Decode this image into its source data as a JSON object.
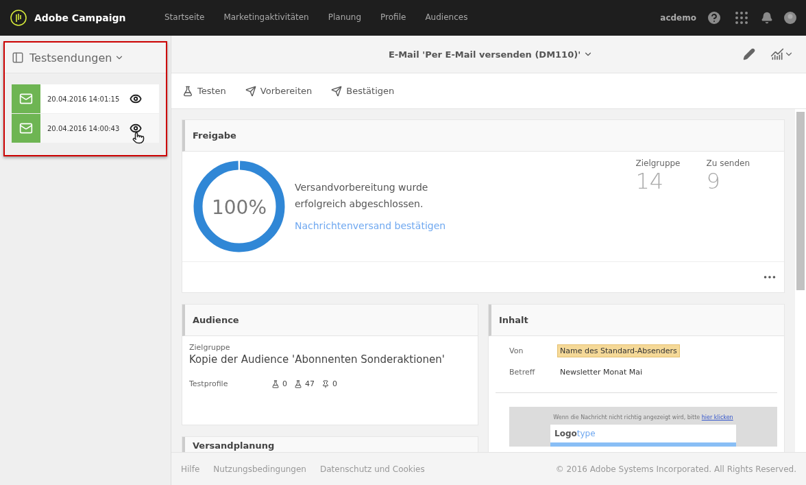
{
  "app": {
    "title": "Adobe Campaign",
    "nav": [
      {
        "label": "Startseite",
        "selected": false
      },
      {
        "label": "Marketingaktivitäten",
        "selected": false
      },
      {
        "label": "Planung",
        "selected": false
      },
      {
        "label": "Profile",
        "selected": false
      },
      {
        "label": "Audiences",
        "selected": false
      }
    ],
    "user": "acdemo"
  },
  "sidebar": {
    "title": "Testsendungen",
    "items": [
      {
        "date": "20.04.2016 14:01:15",
        "hover": false
      },
      {
        "date": "20.04.2016 14:00:43",
        "hover": true
      }
    ]
  },
  "header": {
    "title": "E-Mail 'Per E-Mail versenden (DM110)'"
  },
  "toolbar": [
    {
      "label": "Testen",
      "kind": "test"
    },
    {
      "label": "Vorbereiten",
      "kind": "prepare"
    },
    {
      "label": "Bestätigen",
      "kind": "confirm"
    }
  ],
  "approval": {
    "title": "Freigabe",
    "level": 1,
    "percent": "100%",
    "message": "Versandvorbereitung wurde erfolgreich abgeschlossen.",
    "link": "Nachrichtenversand bestätigen",
    "stats": [
      {
        "label": "Zielgruppe",
        "value": "14"
      },
      {
        "label": "Zu senden",
        "value": "9"
      }
    ]
  },
  "audience": {
    "title": "Audience",
    "target_label": "Zielgruppe",
    "target": "Kopie der Audience 'Abonnenten Sonderaktionen'",
    "test_label": "Testprofile",
    "counts": [
      {
        "kind": "flask",
        "value": "0"
      },
      {
        "kind": "flask-check",
        "value": "47"
      },
      {
        "kind": "pin",
        "value": "0"
      }
    ]
  },
  "content": {
    "title": "Inhalt",
    "fields": [
      {
        "label": "Von",
        "value": "Name des Standard-Absenders",
        "highlighted": true
      },
      {
        "label": "Betreff",
        "value": "Newsletter Monat Mai",
        "highlighted": false
      }
    ],
    "preview": {
      "notice": "Wenn die Nachricht nicht richtig angezeigt wird, bitte",
      "notice_link": "hier klicken",
      "logo_a": "Logo",
      "logo_b": "type"
    }
  },
  "schedule": {
    "title": "Versandplanung"
  },
  "footer": {
    "links": [
      "Hilfe",
      "Nutzungsbedingungen",
      "Datenschutz und Cookies"
    ],
    "copyright": "© 2016 Adobe Systems Incorporated. All Rights Reserved."
  }
}
